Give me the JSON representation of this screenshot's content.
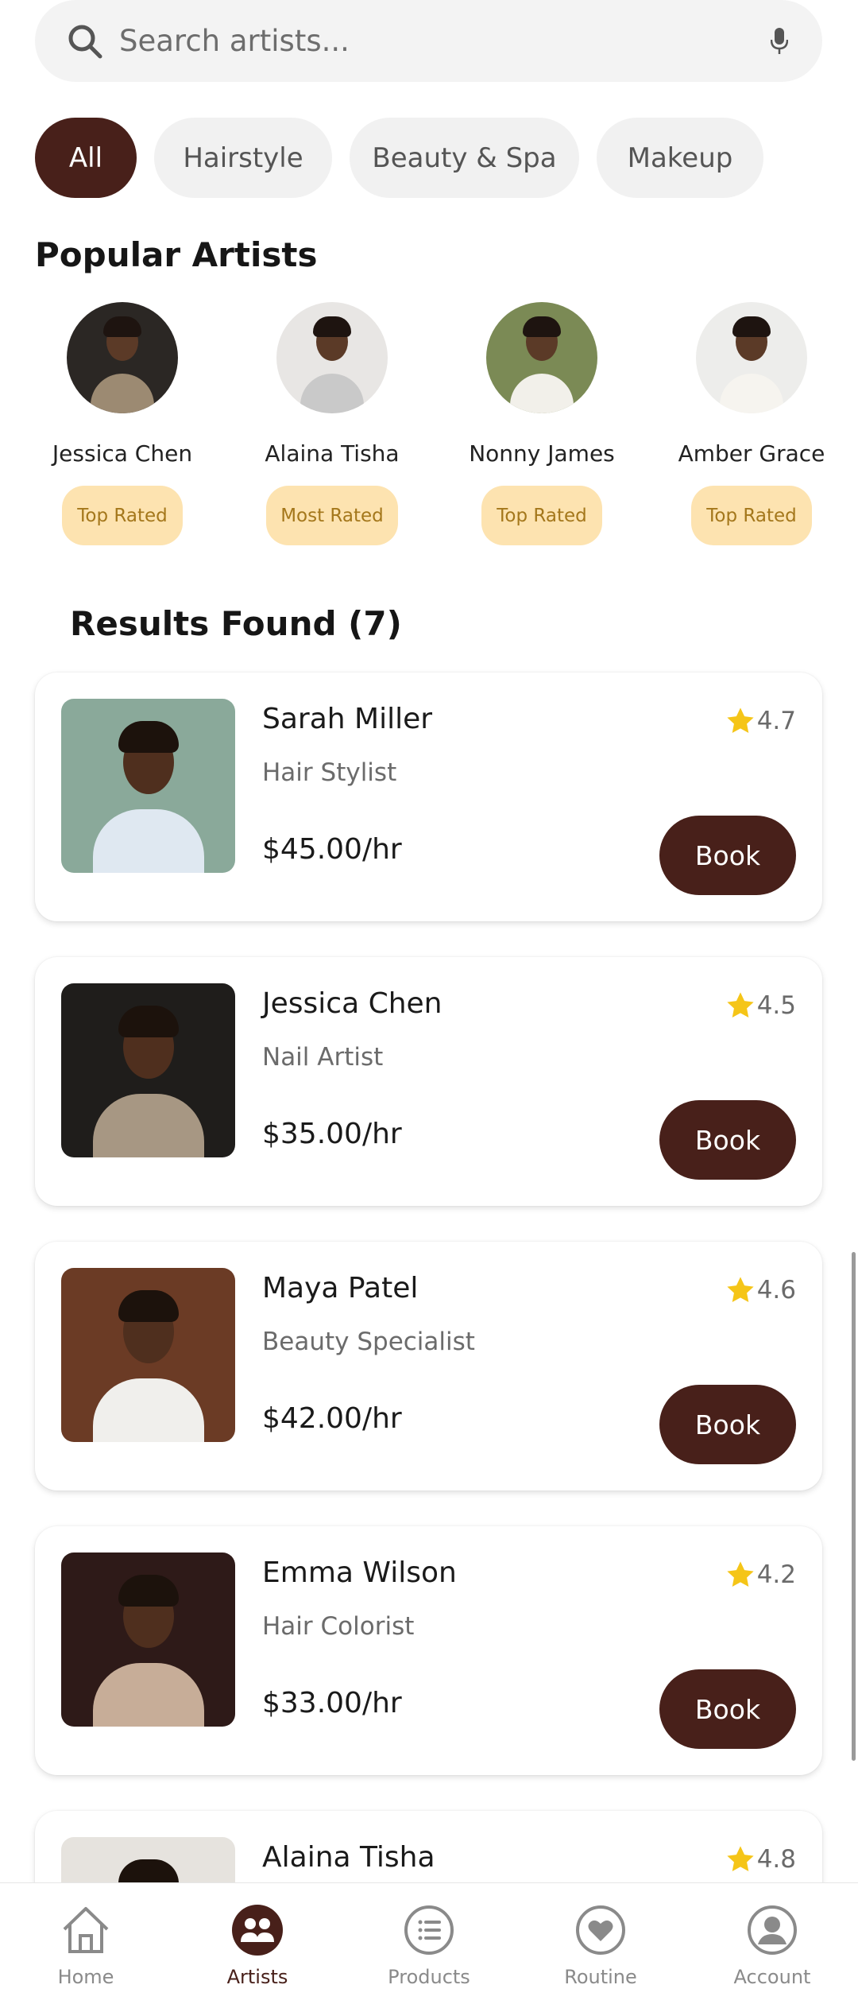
{
  "search": {
    "placeholder": "Search artists..."
  },
  "categories": [
    {
      "label": "All",
      "active": true
    },
    {
      "label": "Hairstyle",
      "active": false
    },
    {
      "label": "Beauty & Spa",
      "active": false
    },
    {
      "label": "Makeup",
      "active": false
    }
  ],
  "popular": {
    "title": "Popular Artists",
    "artists": [
      {
        "name": "Jessica Chen",
        "badge": "Top Rated"
      },
      {
        "name": "Alaina Tisha",
        "badge": "Most Rated"
      },
      {
        "name": "Nonny James",
        "badge": "Top Rated"
      },
      {
        "name": "Amber Grace",
        "badge": "Top Rated"
      }
    ]
  },
  "results": {
    "title": "Results Found (7)",
    "book_label": "Book",
    "items": [
      {
        "name": "Sarah Miller",
        "role": "Hair Stylist",
        "price": "$45.00/hr",
        "rating": "4.7"
      },
      {
        "name": "Jessica Chen",
        "role": "Nail Artist",
        "price": "$35.00/hr",
        "rating": "4.5"
      },
      {
        "name": "Maya Patel",
        "role": "Beauty Specialist",
        "price": "$42.00/hr",
        "rating": "4.6"
      },
      {
        "name": "Emma Wilson",
        "role": "Hair Colorist",
        "price": "$33.00/hr",
        "rating": "4.2"
      },
      {
        "name": "Alaina Tisha",
        "role": "",
        "price": "",
        "rating": "4.8"
      }
    ]
  },
  "nav": [
    {
      "label": "Home",
      "icon": "home-icon",
      "active": false
    },
    {
      "label": "Artists",
      "icon": "artists-icon",
      "active": true
    },
    {
      "label": "Products",
      "icon": "products-icon",
      "active": false
    },
    {
      "label": "Routine",
      "icon": "heart-icon",
      "active": false
    },
    {
      "label": "Account",
      "icon": "account-icon",
      "active": false
    }
  ],
  "colors": {
    "primary": "#48201a",
    "badge_bg": "#fde3b0",
    "badge_text": "#a4771b",
    "star": "#f5c518"
  }
}
